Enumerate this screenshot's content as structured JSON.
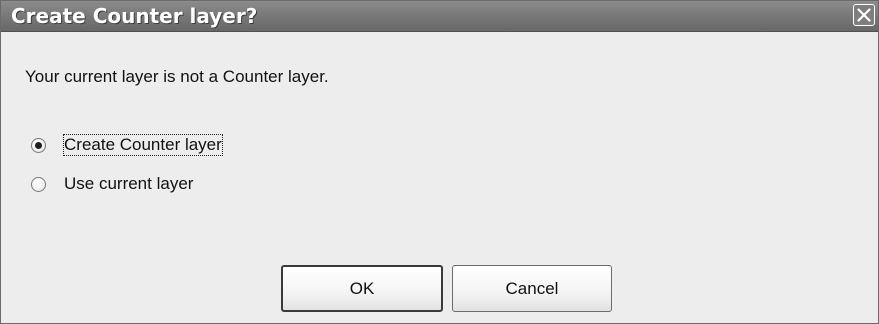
{
  "window": {
    "title": "Create Counter layer?"
  },
  "message": "Your current layer is not a Counter layer.",
  "options": [
    {
      "label": "Create Counter layer",
      "selected": true
    },
    {
      "label": "Use current layer",
      "selected": false
    }
  ],
  "buttons": {
    "ok_label": "OK",
    "cancel_label": "Cancel"
  },
  "icons": {
    "close": "close-icon",
    "radio": "radio-button"
  },
  "colors": {
    "titlebar": "#7a7a7a",
    "dialog_background": "#ededed"
  }
}
